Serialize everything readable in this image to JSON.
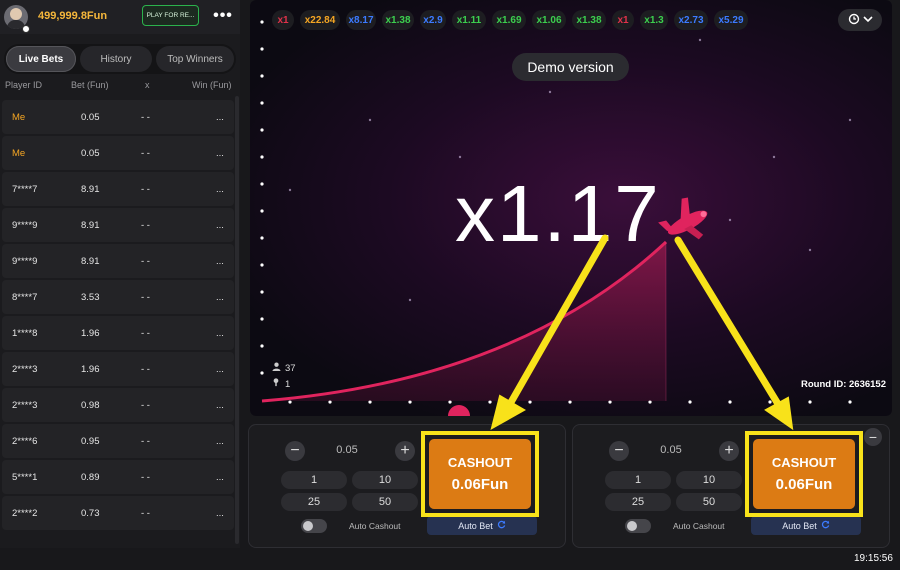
{
  "header": {
    "balance": "499,999.8Fun",
    "play_real_label": "PLAY FOR RE...",
    "menu_label": "•••"
  },
  "tabs": [
    "Live Bets",
    "History",
    "Top Winners"
  ],
  "columns": [
    "Player ID",
    "Bet (Fun)",
    "x",
    "Win (Fun)"
  ],
  "bets": [
    {
      "player": "Me",
      "bet": "0.05",
      "x": "- -",
      "win": "..."
    },
    {
      "player": "Me",
      "bet": "0.05",
      "x": "- -",
      "win": "..."
    },
    {
      "player": "7****7",
      "bet": "8.91",
      "x": "- -",
      "win": "..."
    },
    {
      "player": "9****9",
      "bet": "8.91",
      "x": "- -",
      "win": "..."
    },
    {
      "player": "9****9",
      "bet": "8.91",
      "x": "- -",
      "win": "..."
    },
    {
      "player": "8****7",
      "bet": "3.53",
      "x": "- -",
      "win": "..."
    },
    {
      "player": "1****8",
      "bet": "1.96",
      "x": "- -",
      "win": "..."
    },
    {
      "player": "2****3",
      "bet": "1.96",
      "x": "- -",
      "win": "..."
    },
    {
      "player": "2****3",
      "bet": "0.98",
      "x": "- -",
      "win": "..."
    },
    {
      "player": "2****6",
      "bet": "0.95",
      "x": "- -",
      "win": "..."
    },
    {
      "player": "5****1",
      "bet": "0.89",
      "x": "- -",
      "win": "..."
    },
    {
      "player": "2****2",
      "bet": "0.73",
      "x": "- -",
      "win": "..."
    }
  ],
  "history": [
    {
      "label": "x1",
      "color": "#e0324a"
    },
    {
      "label": "x22.84",
      "color": "#f5a623"
    },
    {
      "label": "x8.17",
      "color": "#3c7bff"
    },
    {
      "label": "x1.38",
      "color": "#3ccf4e"
    },
    {
      "label": "x2.9",
      "color": "#3c7bff"
    },
    {
      "label": "x1.11",
      "color": "#3ccf4e"
    },
    {
      "label": "x1.69",
      "color": "#3ccf4e"
    },
    {
      "label": "x1.06",
      "color": "#3ccf4e"
    },
    {
      "label": "x1.38",
      "color": "#3ccf4e"
    },
    {
      "label": "x1",
      "color": "#e0324a"
    },
    {
      "label": "x1.3",
      "color": "#3ccf4e"
    },
    {
      "label": "x2.73",
      "color": "#3c7bff"
    },
    {
      "label": "x5.29",
      "color": "#3c7bff"
    }
  ],
  "game": {
    "demo_label": "Demo version",
    "multiplier": "x1.17",
    "players_count": "37",
    "winners_count": "1",
    "round_id": "Round ID: 2636152",
    "accent": "#e0245e"
  },
  "bet_panels": [
    {
      "amount": "0.05",
      "minus": "−",
      "plus": "+",
      "quick": [
        "1",
        "10",
        "25",
        "50"
      ],
      "auto_cashout": "Auto Cashout",
      "auto_bet": "Auto Bet",
      "cashout_label": "CASHOUT",
      "cashout_amount": "0.06Fun"
    },
    {
      "amount": "0.05",
      "minus": "−",
      "plus": "+",
      "quick": [
        "1",
        "10",
        "25",
        "50"
      ],
      "auto_cashout": "Auto Cashout",
      "auto_bet": "Auto Bet",
      "cashout_label": "CASHOUT",
      "cashout_amount": "0.06Fun"
    }
  ],
  "remove_panel_label": "−",
  "clock": "19:15:56",
  "icons": [
    "avatar",
    "history-clock-icon",
    "chevron-down-icon",
    "user-icon",
    "trophy-icon",
    "airplane-icon",
    "refresh-icon"
  ]
}
